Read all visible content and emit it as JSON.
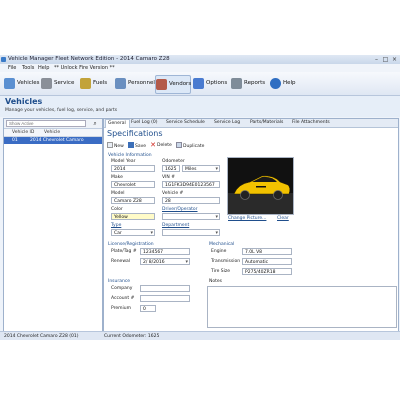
{
  "window": {
    "title": "Vehicle Manager Fleet Network Edition - 2014 Camaro Z28"
  },
  "menu": {
    "file": "File",
    "tools": "Tools",
    "help": "Help",
    "unlock": "** Unlock Fire Version **"
  },
  "toolbar": {
    "vehicles": "Vehicles",
    "service": "Service",
    "fuels": "Fuels",
    "personnel": "Personnel",
    "vendors": "Vendors",
    "options": "Options",
    "reports": "Reports",
    "help": "Help"
  },
  "page": {
    "title": "Vehicles",
    "subtitle": "Manage your vehicles, fuel log, service, and parts"
  },
  "left": {
    "search_placeholder": "Show Active",
    "headers": {
      "vehicle_id": "Vehicle ID",
      "vehicle": "Vehicle"
    },
    "rows": [
      {
        "id": "01",
        "vehicle": "2014 Chevrolet Camaro"
      }
    ]
  },
  "tabs": [
    "General",
    "Fuel Log (0)",
    "Service Schedule",
    "Service Log",
    "Parts/Materials",
    "File Attachments"
  ],
  "section_title": "Specifications",
  "actions": {
    "new": "New",
    "save": "Save",
    "delete": "Delete",
    "duplicate": "Duplicate"
  },
  "vehicle_info": {
    "group": "Vehicle Information",
    "model_year_label": "Model Year",
    "model_year": "2014",
    "odometer_label": "Odometer",
    "odometer": "1625",
    "odometer_unit": "Miles",
    "make_label": "Make",
    "make": "Chevrolet",
    "vin_label": "VIN #",
    "vin": "1G1FK3D94E0123567",
    "model_label": "Model",
    "model": "Camaro Z28",
    "vehicle_no_label": "Vehicle #",
    "vehicle_no": "28",
    "color_label": "Color",
    "color": "Yellow",
    "driver_label": "Driver/Operator",
    "driver": "",
    "type_label": "Type",
    "type": "Car",
    "department_label": "Department",
    "department": ""
  },
  "photo": {
    "change": "Change Picture...",
    "clear": "Clear"
  },
  "license": {
    "group": "License/Registration",
    "plate_label": "Plate/Tag #",
    "plate": "1234567",
    "renewal_label": "Renewal",
    "renewal": "2/ 8/2016"
  },
  "mechanical": {
    "group": "Mechanical",
    "engine_label": "Engine",
    "engine": "7.0L V8",
    "transmission_label": "Transmission",
    "transmission": "Automatic",
    "tire_label": "Tire Size",
    "tire": "P275/40ZR18"
  },
  "insurance": {
    "group": "Insurance",
    "company_label": "Company",
    "company": "",
    "account_label": "Account #",
    "account": "",
    "premium_label": "Premium",
    "premium": "0"
  },
  "notes": {
    "label": "Notes"
  },
  "status": {
    "vehicle": "2014 Chevrolet Camaro Z28 (01)",
    "odometer": "Current Odometer: 1625"
  },
  "colors": {
    "accent": "#1f4e8c",
    "selection": "#3a6cc4",
    "car_body": "#f2c200"
  }
}
